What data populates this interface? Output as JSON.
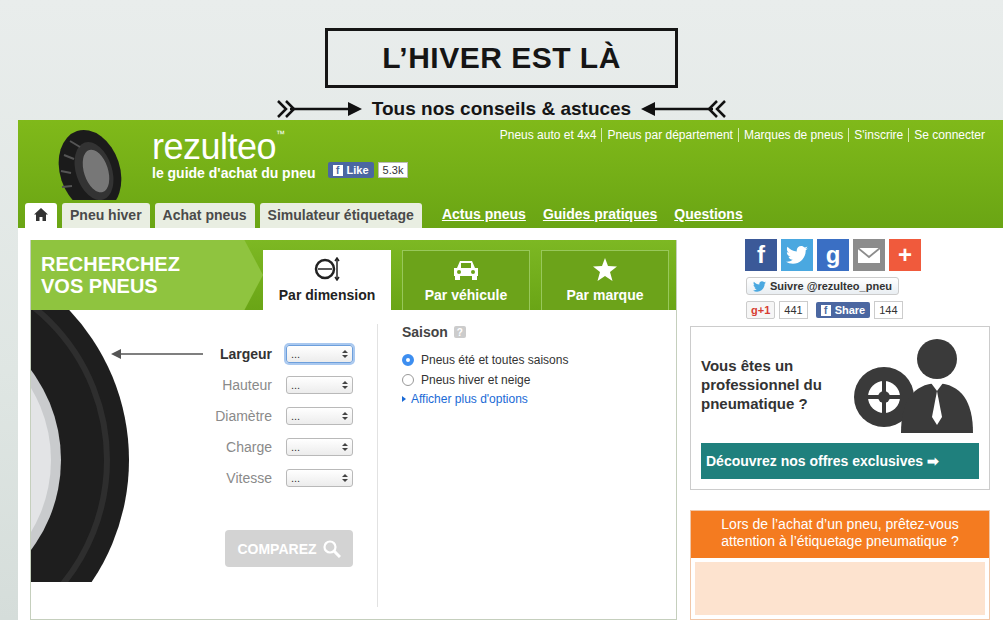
{
  "banner": {
    "title": "L’HIVER EST LÀ",
    "subtitle": "Tous nos conseils & astuces"
  },
  "header": {
    "logo": "rezulteo",
    "trademark": "™",
    "tagline": "le guide d'achat du pneu",
    "like": {
      "glyph": "f",
      "label": "Like",
      "count": "5.3k"
    },
    "top_links": [
      "Pneus auto et 4x4",
      "Pneus par département",
      "Marques de pneus",
      "S'inscrire",
      "Se connecter"
    ]
  },
  "nav": {
    "home": {
      "selected": true
    },
    "tabs": [
      {
        "label": "Pneu hiver",
        "selected": false
      },
      {
        "label": "Achat pneus",
        "selected": false
      },
      {
        "label": "Simulateur étiquetage",
        "selected": false
      }
    ],
    "links": [
      "Actus pneus",
      "Guides pratiques",
      "Questions"
    ]
  },
  "search": {
    "title_lines": [
      "RECHERCHEZ",
      "VOS PNEUS"
    ],
    "tabs": [
      {
        "label": "Par dimension",
        "kind": "dimension",
        "selected": true
      },
      {
        "label": "Par véhicule",
        "kind": "vehicle",
        "selected": false
      },
      {
        "label": "Par marque",
        "kind": "brand",
        "selected": false
      }
    ],
    "fields": [
      {
        "label": "Largeur",
        "value": "...",
        "active": true
      },
      {
        "label": "Hauteur",
        "value": "...",
        "active": false
      },
      {
        "label": "Diamètre",
        "value": "...",
        "active": false
      },
      {
        "label": "Charge",
        "value": "...",
        "active": false
      },
      {
        "label": "Vitesse",
        "value": "...",
        "active": false
      }
    ],
    "button": {
      "label": "COMPAREZ",
      "disabled": true
    },
    "season": {
      "label": "Saison",
      "help": "?",
      "options": [
        {
          "label": "Pneus été et toutes saisons",
          "selected": true
        },
        {
          "label": "Pneus hiver et neige",
          "selected": false
        }
      ],
      "more": "Afficher plus d'options"
    }
  },
  "sidebar": {
    "social": [
      {
        "kind": "facebook",
        "glyph": "f",
        "color": "#3b5998"
      },
      {
        "kind": "twitter",
        "glyph": "",
        "color": "#4aa8e0"
      },
      {
        "kind": "google",
        "glyph": "g",
        "color": "#3a6fc4"
      },
      {
        "kind": "mail",
        "glyph": "",
        "color": "#8c8c8c"
      },
      {
        "kind": "plus",
        "glyph": "+",
        "color": "#f05a3c"
      }
    ],
    "follow": "Suivre @rezulteo_pneu",
    "gplus": {
      "label": "g+1",
      "count": "441"
    },
    "share": {
      "glyph": "f",
      "label": "Share",
      "count": "144"
    },
    "pro": {
      "text": "Vous êtes un professionnel du pneumatique ?",
      "button": "Découvrez nos offres exclusives",
      "arrow": "➡"
    },
    "promo": {
      "text": "Lors de l’achat d’un pneu, prêtez-vous attention à l’étiquetage pneumatique ?"
    }
  }
}
